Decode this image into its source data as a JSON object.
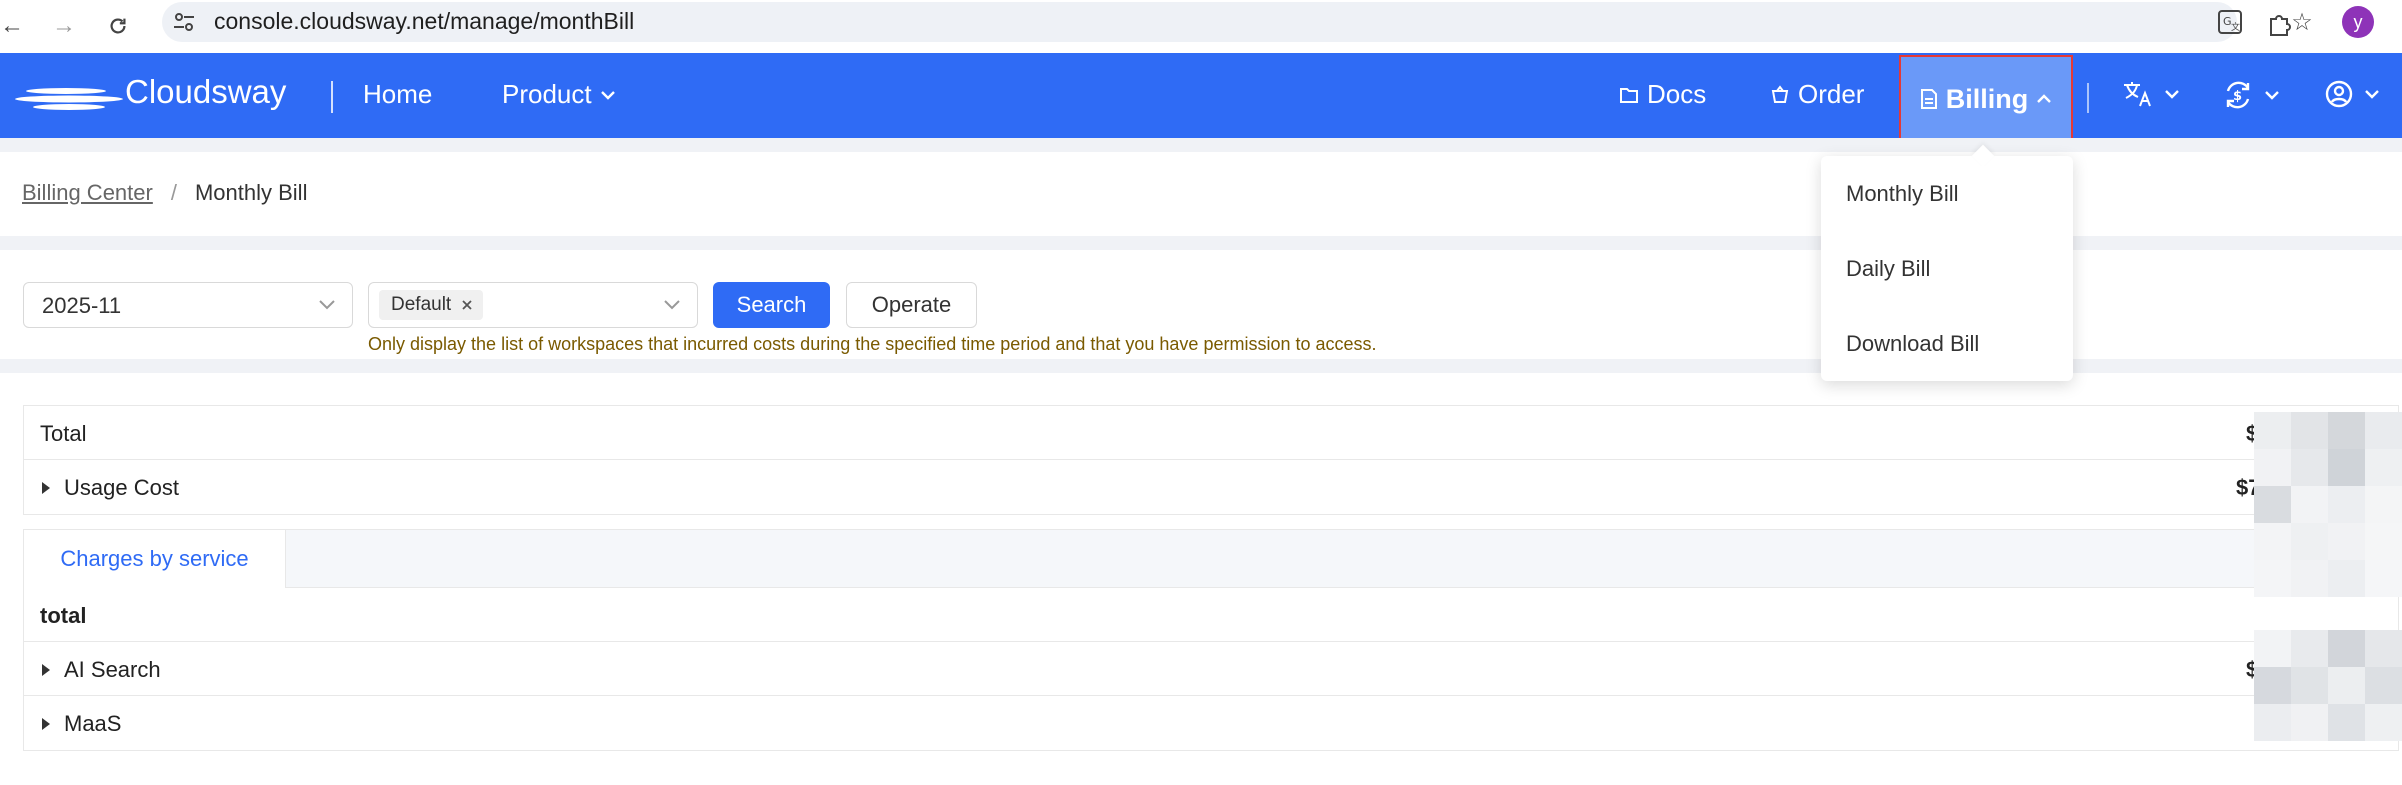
{
  "browser": {
    "url": "console.cloudsway.net/manage/monthBill",
    "profile_initial": "y"
  },
  "nav": {
    "brand": "Cloudsway",
    "home": "Home",
    "product": "Product",
    "docs": "Docs",
    "order": "Order",
    "billing": "Billing"
  },
  "breadcrumb": {
    "parent": "Billing Center",
    "separator": "/",
    "current": "Monthly Bill"
  },
  "filters": {
    "month": "2025-11",
    "workspace_tag": "Default",
    "search_label": "Search",
    "operate_label": "Operate",
    "hint": "Only display the list of workspaces that incurred costs during the specified time period and that you have permission to access."
  },
  "summary": {
    "total_label": "Total",
    "total_amount": "$",
    "usage_label": "Usage Cost",
    "usage_amount": "$7"
  },
  "service_table": {
    "tab_label": "Charges by service",
    "total_label": "total",
    "rows": [
      {
        "label": "AI Search",
        "amount": "$"
      },
      {
        "label": "MaaS",
        "amount": ""
      }
    ]
  },
  "billing_menu": {
    "items": [
      "Monthly Bill",
      "Daily Bill",
      "Download Bill"
    ]
  },
  "colors": {
    "primary": "#2f6bf5",
    "billing_highlight": "#6a99f8",
    "highlight_border": "#e53935"
  }
}
